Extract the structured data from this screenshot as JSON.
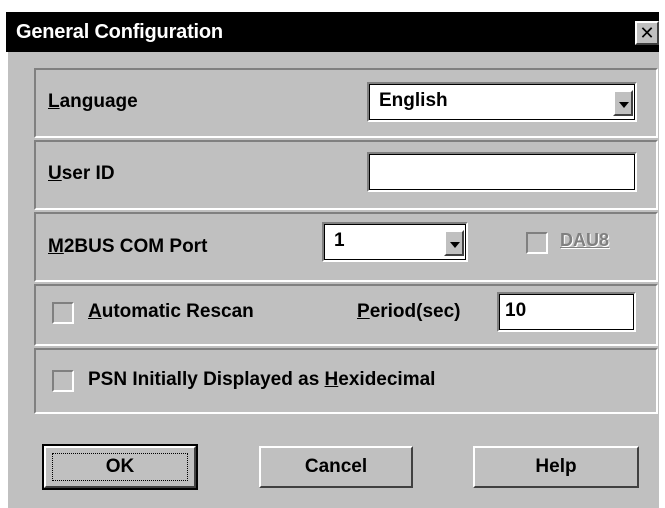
{
  "window": {
    "title": "General Configuration",
    "close_glyph": "✕"
  },
  "language": {
    "label_prefix": "",
    "label_mnemonic": "L",
    "label_rest": "anguage",
    "value": "English"
  },
  "user_id": {
    "label_mnemonic": "U",
    "label_rest": "ser ID",
    "value": ""
  },
  "com_port": {
    "label_mnemonic": "M",
    "label_rest": "2BUS COM Port",
    "value": "1",
    "dau8_label": "DAU8",
    "dau8_checked": false
  },
  "rescan": {
    "label_mnemonic": "A",
    "label_rest": "utomatic Rescan",
    "checked": false,
    "period_mnemonic": "P",
    "period_rest": "eriod(sec)",
    "period_value": "10"
  },
  "psn": {
    "label_prefix": "PSN Initially Displayed as ",
    "label_mnemonic": "H",
    "label_rest": "exidecimal",
    "checked": false
  },
  "buttons": {
    "ok": "OK",
    "cancel": "Cancel",
    "help": "Help"
  }
}
